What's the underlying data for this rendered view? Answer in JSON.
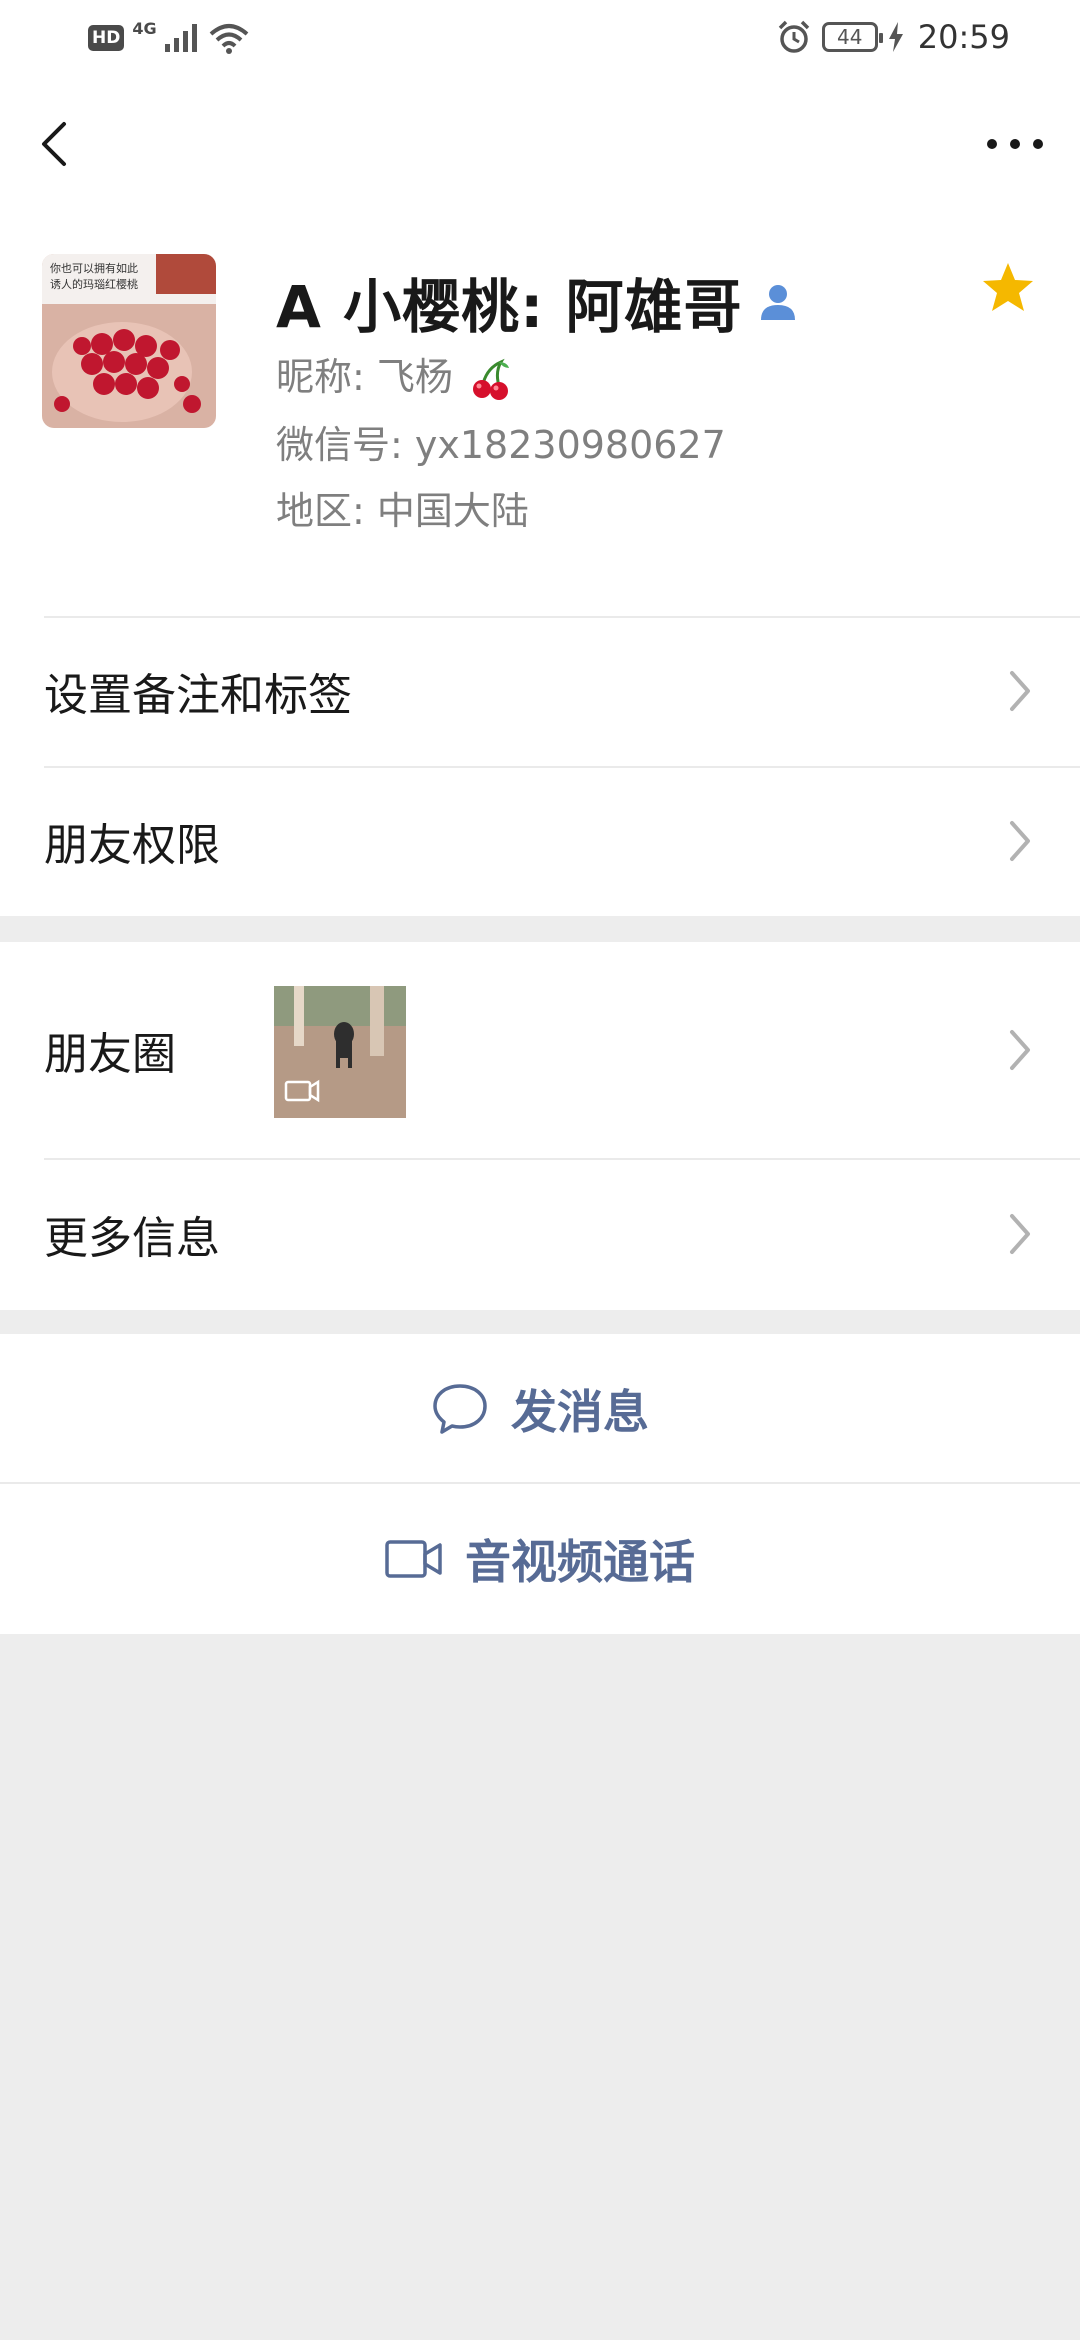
{
  "status_bar": {
    "hd": "HD",
    "network": "4G",
    "battery": "44",
    "time": "20:59"
  },
  "icons": {
    "back": "chevron-left-icon",
    "more": "more-dots-icon",
    "contact": "contact-person-icon",
    "star": "star-icon",
    "chevron": "chevron-right-icon",
    "message": "chat-bubble-icon",
    "video": "video-camera-icon"
  },
  "colors": {
    "star": "#f5b800",
    "contact_icon": "#5b8fd8",
    "link_blue": "#576b95",
    "background": "#ededed"
  },
  "profile": {
    "name": "A 小樱桃: 阿雄哥",
    "nickname": "昵称:  飞杨",
    "wechat_id": "微信号:  yx18230980627",
    "region": "地区:  中国大陆",
    "avatar_caption_line1": "你也可以拥有如此",
    "avatar_caption_line2": "诱人的玛瑙红樱桃"
  },
  "menu": {
    "remark_tags": "设置备注和标签",
    "friend_permissions": "朋友权限",
    "moments": "朋友圈",
    "more_info": "更多信息"
  },
  "actions": {
    "send_message": "发消息",
    "video_call": "音视频通话"
  }
}
